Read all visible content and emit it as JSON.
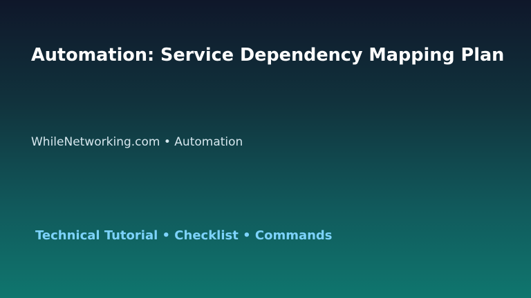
{
  "slide": {
    "title": "Automation: Service Dependency Mapping Plan",
    "subtitle": "WhileNetworking.com • Automation",
    "tagline": "Technical Tutorial • Checklist • Commands"
  },
  "colors": {
    "background_top": "#0f172a",
    "background_bottom": "#0f766e",
    "title": "#ffffff",
    "subtitle": "#d6e7ee",
    "tagline": "#7dd3fc"
  }
}
